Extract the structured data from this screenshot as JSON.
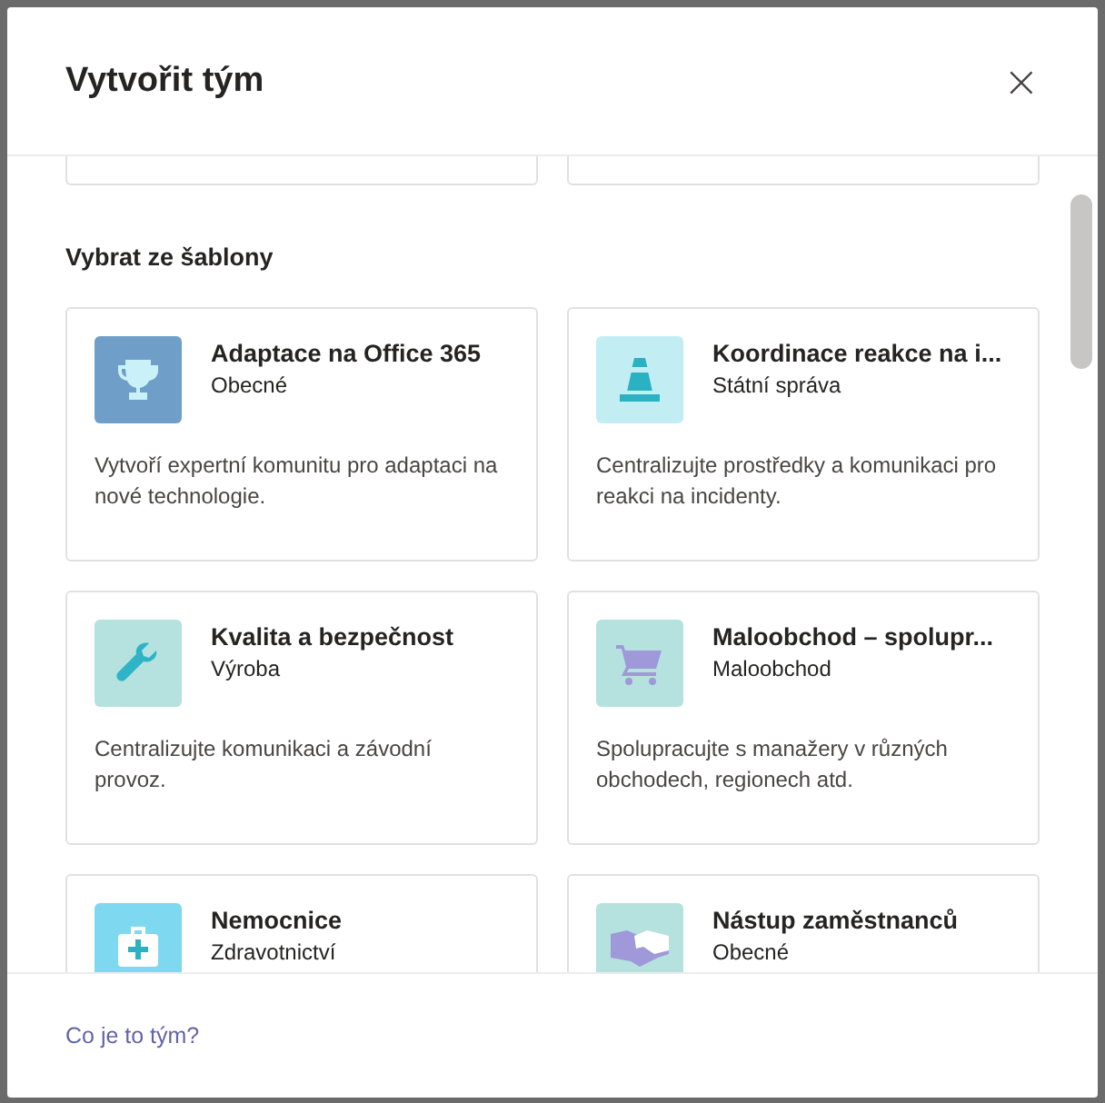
{
  "dialog": {
    "title": "Vytvořit tým",
    "close": "×"
  },
  "section_title": "Vybrat ze šablony",
  "templates": [
    {
      "kind": "trophy",
      "color": "#6f9fc9",
      "title": "Adaptace na Office 365",
      "category": "Obecné",
      "description": "Vytvoří expertní komunitu pro adaptaci na nové technologie."
    },
    {
      "kind": "cone",
      "color": "#c2eef3",
      "title": "Koordinace reakce na i...",
      "category": "Státní správa",
      "description": "Centralizujte prostředky a komunikaci pro reakci na incidenty."
    },
    {
      "kind": "wrench",
      "color": "#b5e2de",
      "title": "Kvalita a bezpečnost",
      "category": "Výroba",
      "description": "Centralizujte komunikaci a závodní provoz."
    },
    {
      "kind": "cart",
      "color": "#b5e2de",
      "title": "Maloobchod – spolupr...",
      "category": "Maloobchod",
      "description": "Spolupracujte s manažery v různých obchodech, regionech atd."
    },
    {
      "kind": "medkit",
      "color": "#7ed8ef",
      "title": "Nemocnice",
      "category": "Zdravotnictví"
    },
    {
      "kind": "handshake",
      "color": "#b5e2de",
      "title": "Nástup zaměstnanců",
      "category": "Obecné"
    }
  ],
  "footer_link": "Co je to tým?"
}
